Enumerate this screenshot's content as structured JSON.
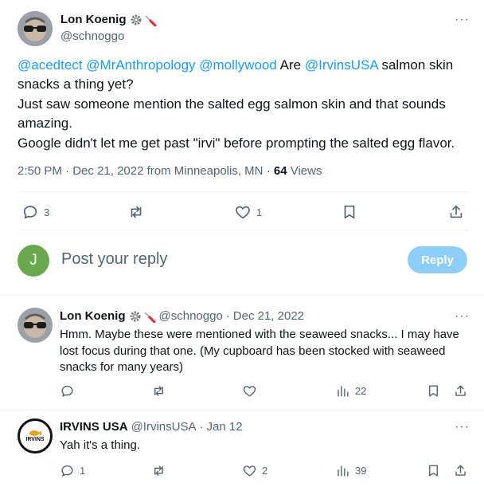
{
  "main_tweet": {
    "author_name": "Lon Koenig",
    "author_handle": "@schnoggo",
    "badge_icons": [
      "gear-icon",
      "screwdriver-icon"
    ],
    "text": {
      "mentions": [
        "@acedtect",
        "@MrAnthropology",
        "@mollywood"
      ],
      "word_are": "Are",
      "mention_irvins": "@IrvinsUSA",
      "line1_rest": "salmon skin",
      "line2": "snacks a thing yet?",
      "line3": "Just saw someone mention the salted egg salmon skin and that sounds",
      "line4": "amazing.",
      "line5": "Google didn't let me get past \"irvi\" before prompting the salted egg flavor."
    },
    "meta": {
      "time": "2:50 PM",
      "sep1": "·",
      "date": "Dec 21, 2022",
      "location": "from Minneapolis, MN",
      "sep2": "·",
      "views_count": "64",
      "views_label": "Views"
    },
    "actions": {
      "replies": "3",
      "retweets": "",
      "likes": "1"
    }
  },
  "reply_box": {
    "avatar_letter": "J",
    "placeholder": "Post your reply",
    "button_label": "Reply"
  },
  "replies": [
    {
      "author_name": "Lon Koenig",
      "author_handle": "@schnoggo",
      "sep": "·",
      "date": "Dec 21, 2022",
      "text_line1": "Hmm. Maybe these were mentioned with the seaweed snacks... I may have",
      "text_line2": "lost focus during that one. (My cupboard has been stocked with seaweed",
      "text_line3": "snacks for many years)",
      "views": "22"
    },
    {
      "author_name": "IRVINS USA",
      "author_handle": "@IrvinsUSA",
      "sep": "·",
      "date": "Jan 12",
      "avatar_text": "IRVINS",
      "text_line1": "Yah it's a thing.",
      "replies": "1",
      "likes": "2",
      "views": "39"
    }
  ],
  "colors": {
    "link": "#1d9bf0",
    "muted": "#536471",
    "reply_button_disabled": "#8ecdf8",
    "avatar_green": "#6aa84f"
  }
}
